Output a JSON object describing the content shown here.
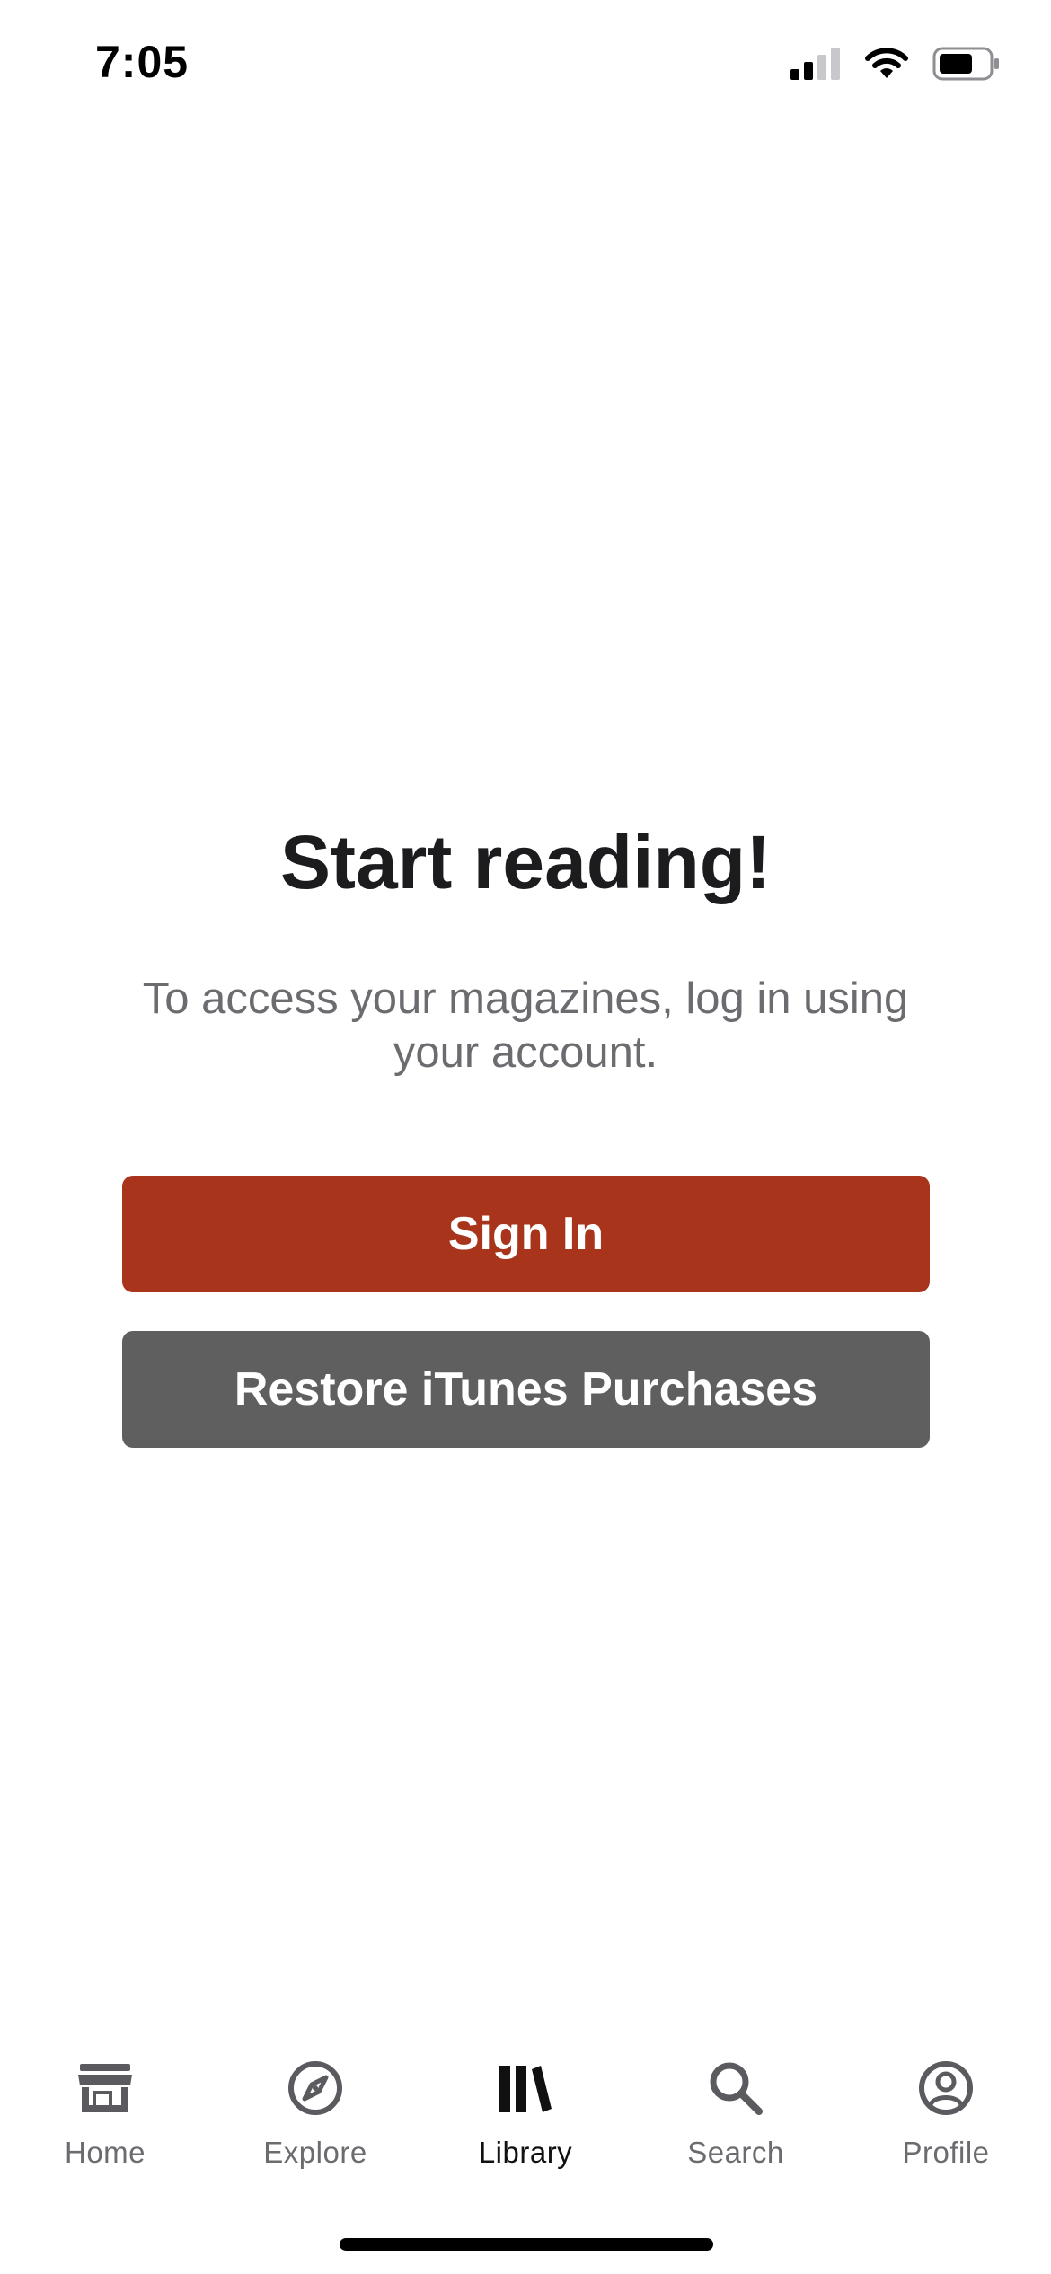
{
  "status_bar": {
    "time": "7:05",
    "icons": [
      "signal-icon",
      "wifi-icon",
      "battery-icon"
    ]
  },
  "main": {
    "title": "Start reading!",
    "subtitle": "To access your magazines, log in using your account.",
    "sign_in_label": "Sign In",
    "restore_label": "Restore iTunes Purchases"
  },
  "tab_bar": {
    "items": [
      {
        "label": "Home",
        "icon": "storefront-icon",
        "active": false
      },
      {
        "label": "Explore",
        "icon": "compass-icon",
        "active": false
      },
      {
        "label": "Library",
        "icon": "library-icon",
        "active": true
      },
      {
        "label": "Search",
        "icon": "search-icon",
        "active": false
      },
      {
        "label": "Profile",
        "icon": "profile-icon",
        "active": false
      }
    ]
  },
  "colors": {
    "sign_in_button": "#a8341c",
    "restore_button": "#5f5f5f",
    "inactive_tab": "#6b6b70",
    "active_tab": "#111111"
  }
}
